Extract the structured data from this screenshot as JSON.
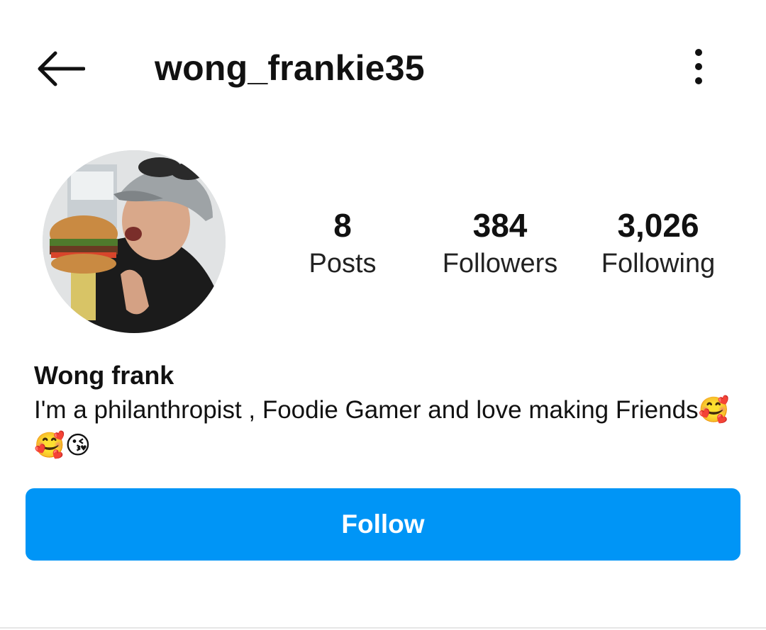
{
  "header": {
    "back_icon": "arrow-left-icon",
    "username": "wong_frankie35",
    "more_icon": "more-vertical-icon"
  },
  "profile": {
    "avatar_description": "profile-photo",
    "stats": [
      {
        "count": "8",
        "label": "Posts"
      },
      {
        "count": "384",
        "label": "Followers"
      },
      {
        "count": "3,026",
        "label": "Following"
      }
    ],
    "display_name": "Wong frank",
    "bio": "I'm a philanthropist , Foodie Gamer and love making Friends🥰🥰😘"
  },
  "actions": {
    "follow_label": "Follow"
  },
  "colors": {
    "accent": "#0095f6",
    "text": "#111111"
  }
}
